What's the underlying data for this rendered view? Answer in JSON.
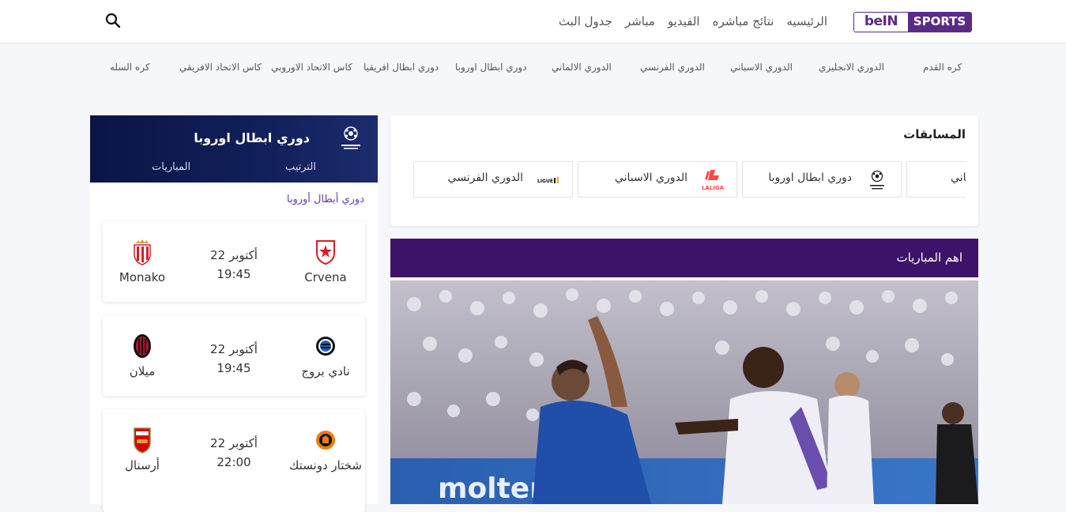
{
  "header": {
    "logo": {
      "part1": "beIN",
      "part2": "SPORTS"
    },
    "nav": [
      "الرئيسيه",
      "نتائج مباشره",
      "الفيديو",
      "مباشر",
      "جدول البث"
    ]
  },
  "subnav": [
    "كره القدم",
    "الدوري الانجليزي",
    "الدوري الاسباني",
    "الدوري الفرنسي",
    "الدوري الالماني",
    "دوري ابطال اوروبا",
    "دوري ابطال افريقيا",
    "كاس الاتحاد الاوروبي",
    "كاس الاتحاد الافريقي",
    "كره السله"
  ],
  "left_panel": {
    "title": "دوري ابطال اوروبا",
    "tabs": [
      "الترتيب",
      "المباريات"
    ],
    "competition_label": "دوري أبطال أوروبا",
    "matches": [
      {
        "home": "Crvena",
        "away": "Monako",
        "date": "22 أكتوبر",
        "time": "19:45"
      },
      {
        "home": "نادي بروج",
        "away": "ميلان",
        "date": "22 أكتوبر",
        "time": "19:45"
      },
      {
        "home": "شختار دونستك",
        "away": "أرسنال",
        "date": "22 أكتوبر",
        "time": "22:00"
      }
    ]
  },
  "competitions": {
    "title": "المسابقات",
    "items": [
      {
        "label": "الماني",
        "icon": "bundesliga-icon"
      },
      {
        "label": "دوري ابطال اوروبا",
        "icon": "champions-league-icon"
      },
      {
        "label": "الدوري الاسباني",
        "icon": "laliga-icon"
      },
      {
        "label": "الدوري الفرنسي",
        "icon": "ligue1-icon"
      }
    ]
  },
  "top_matches": {
    "title": "اهم المباريات"
  },
  "colors": {
    "brand": "#5b2a86",
    "top_matches_bar": "#3d1269",
    "panel_header": "#0c1446"
  }
}
